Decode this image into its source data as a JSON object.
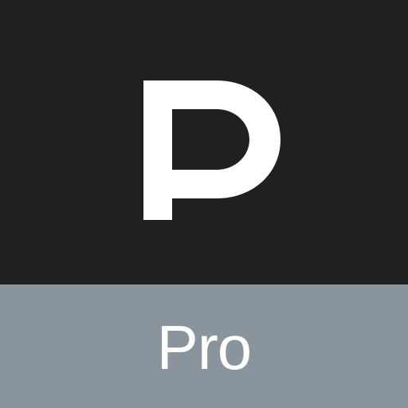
{
  "badge": {
    "label": "Pro"
  },
  "logo": {
    "letter": "P"
  },
  "colors": {
    "top_background": "#202020",
    "bottom_band": "#8a949d",
    "mark": "#ffffff",
    "label_text": "#ffffff"
  }
}
